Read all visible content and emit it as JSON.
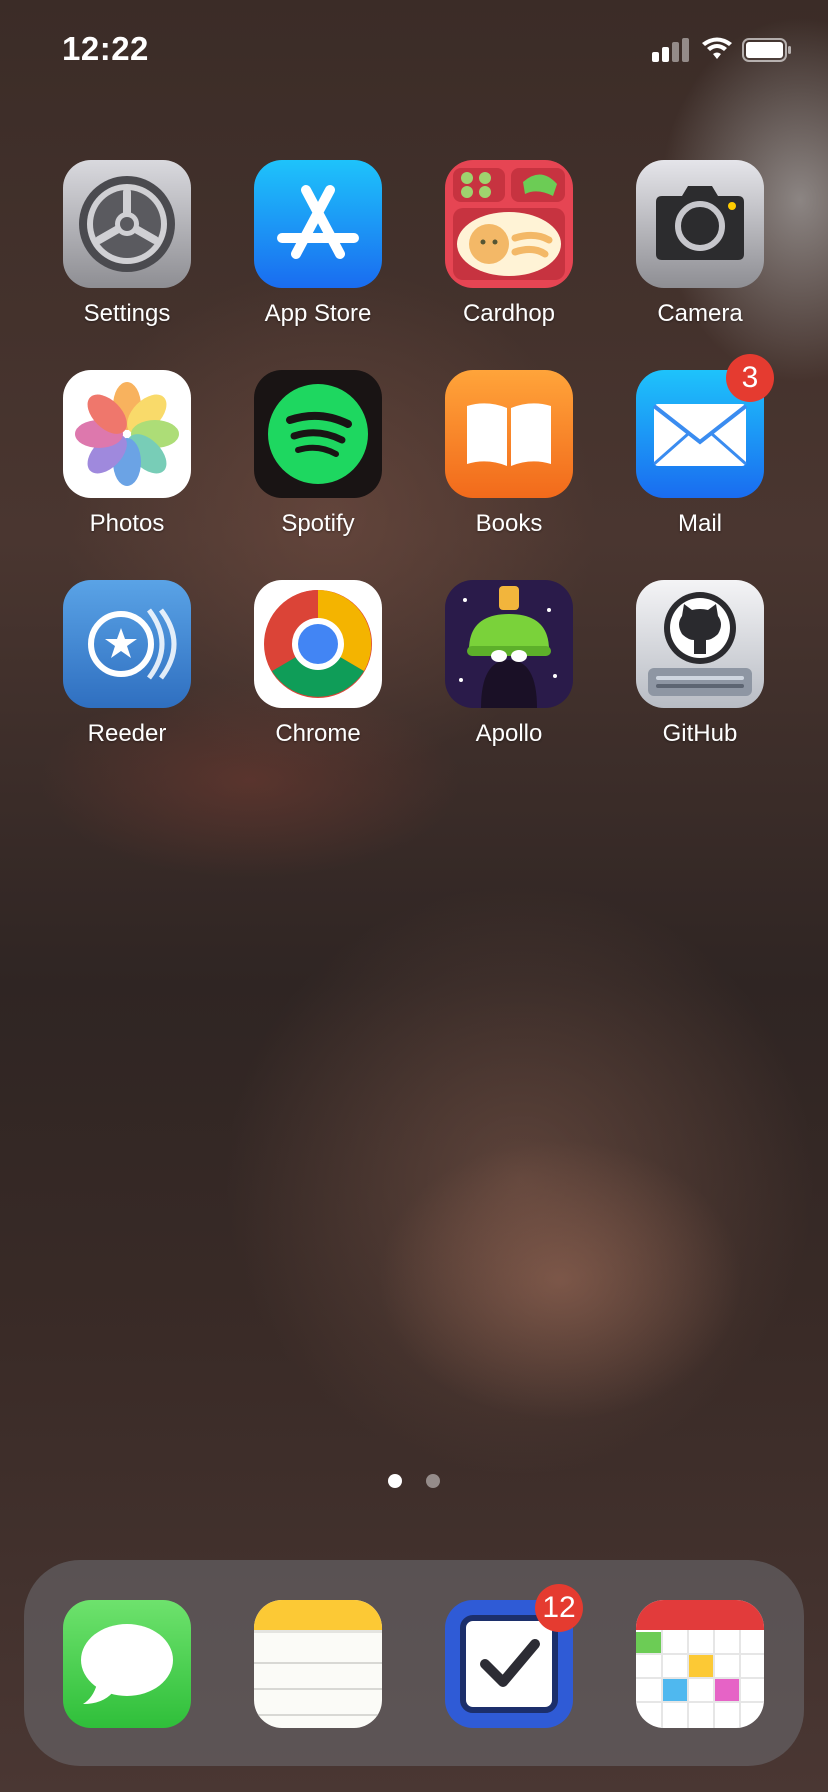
{
  "status_bar": {
    "time": "12:22"
  },
  "home_apps": [
    {
      "name": "Settings",
      "icon": "settings-gear-icon"
    },
    {
      "name": "App Store",
      "icon": "app-store-icon"
    },
    {
      "name": "Cardhop",
      "icon": "cardhop-icon"
    },
    {
      "name": "Camera",
      "icon": "camera-icon"
    },
    {
      "name": "Photos",
      "icon": "photos-icon"
    },
    {
      "name": "Spotify",
      "icon": "spotify-icon"
    },
    {
      "name": "Books",
      "icon": "books-icon"
    },
    {
      "name": "Mail",
      "icon": "mail-icon",
      "badge": "3"
    },
    {
      "name": "Reeder",
      "icon": "reeder-icon"
    },
    {
      "name": "Chrome",
      "icon": "chrome-icon"
    },
    {
      "name": "Apollo",
      "icon": "apollo-icon"
    },
    {
      "name": "GitHub",
      "icon": "github-icon"
    }
  ],
  "dock_apps": [
    {
      "icon": "messages-icon"
    },
    {
      "icon": "notes-icon"
    },
    {
      "icon": "tasks-icon",
      "badge": "12"
    },
    {
      "icon": "calendar-icon"
    }
  ],
  "page_indicator": {
    "pages": 2,
    "current": 1
  },
  "colors": {
    "badge": "#e53b30",
    "dock": "#6e6e73"
  }
}
